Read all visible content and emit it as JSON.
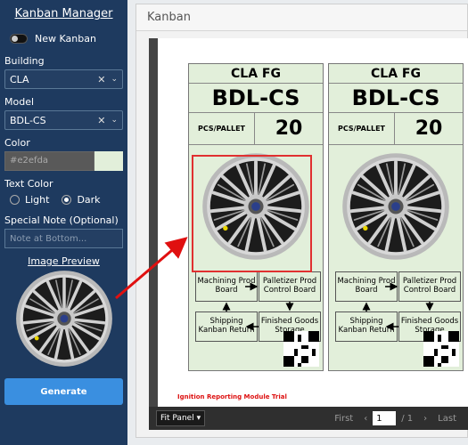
{
  "sidebar": {
    "title": "Kanban Manager",
    "new_kanban_label": "New Kanban",
    "building_label": "Building",
    "building_value": "CLA",
    "model_label": "Model",
    "model_value": "BDL-CS",
    "color_label": "Color",
    "color_value": "#e2efda",
    "text_color_label": "Text Color",
    "light_label": "Light",
    "dark_label": "Dark",
    "text_color_selected": "Dark",
    "special_note_label": "Special Note (Optional)",
    "special_note_placeholder": "Note at Bottom...",
    "image_preview_label": "Image Preview",
    "generate_label": "Generate"
  },
  "main": {
    "header_title": "Kanban",
    "card": {
      "building": "CLA FG",
      "model": "BDL-CS",
      "pcs_label": "PCS/PALLET",
      "pcs_value": "20",
      "flow": {
        "machining": "Machining Prod Board",
        "palletizer": "Palletizer Prod Control Board",
        "shipping": "Shipping Kanban Return",
        "finished": "Finished Goods Storage"
      }
    },
    "footnote": "Ignition Reporting Module Trial",
    "pager": {
      "fit_label": "Fit Panel",
      "first_label": "First",
      "page_value": "1",
      "of_label": "/ 1",
      "last_label": "Last"
    }
  },
  "colors": {
    "sidebar_bg": "#1e3a5f",
    "card_bg": "#e2efda",
    "highlight": "#e03030",
    "generate_button": "#3a8fe0"
  }
}
